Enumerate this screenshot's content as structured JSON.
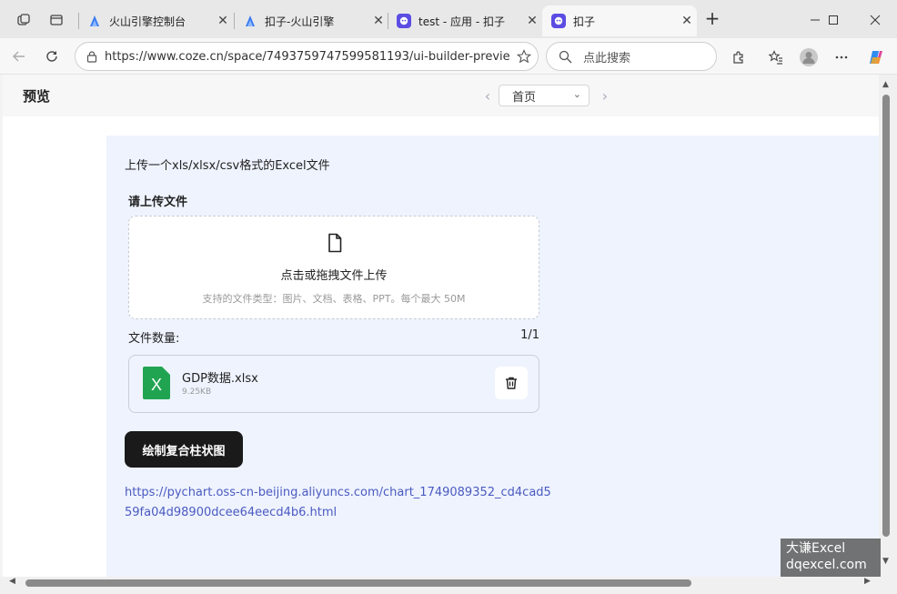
{
  "browser": {
    "tabs": [
      {
        "label": "火山引擎控制台",
        "icon": "volcengine-icon",
        "active": false
      },
      {
        "label": "扣子-火山引擎",
        "icon": "volcengine-icon",
        "active": false
      },
      {
        "label": "test - 应用 - 扣子",
        "icon": "coze-icon",
        "active": false
      },
      {
        "label": "扣子",
        "icon": "coze-icon",
        "active": true
      }
    ],
    "url": "https://www.coze.cn/space/7493759747599581193/ui-builder-previe...",
    "search_placeholder": "点此搜索"
  },
  "preview": {
    "title": "预览",
    "page_select": "首页"
  },
  "form": {
    "description": "上传一个xls/xlsx/csv格式的Excel文件",
    "upload_label": "请上传文件",
    "dropzone_main": "点击或拖拽文件上传",
    "dropzone_hint": "支持的文件类型：图片、文档、表格、PPT。每个最大 50M",
    "count_label": "文件数量:",
    "count_value": "1/1",
    "file": {
      "name": "GDP数据.xlsx",
      "size": "9.25KB",
      "type_glyph": "X"
    },
    "button_label": "绘制复合柱状图",
    "result_link": "https://pychart.oss-cn-beijing.aliyuncs.com/chart_1749089352_cd4cad559fa04d98900dcee64eecd4b6.html"
  },
  "watermark": {
    "line1": "大谦Excel",
    "line2": "dqexcel.com"
  },
  "colors": {
    "panel_bg": "#eef3fe",
    "button_bg": "#1a1a1a",
    "link": "#4b5ac0",
    "excel_green": "#21a452",
    "coze_purple": "#5b4de3",
    "volc_blue": "#3a7cf0"
  }
}
